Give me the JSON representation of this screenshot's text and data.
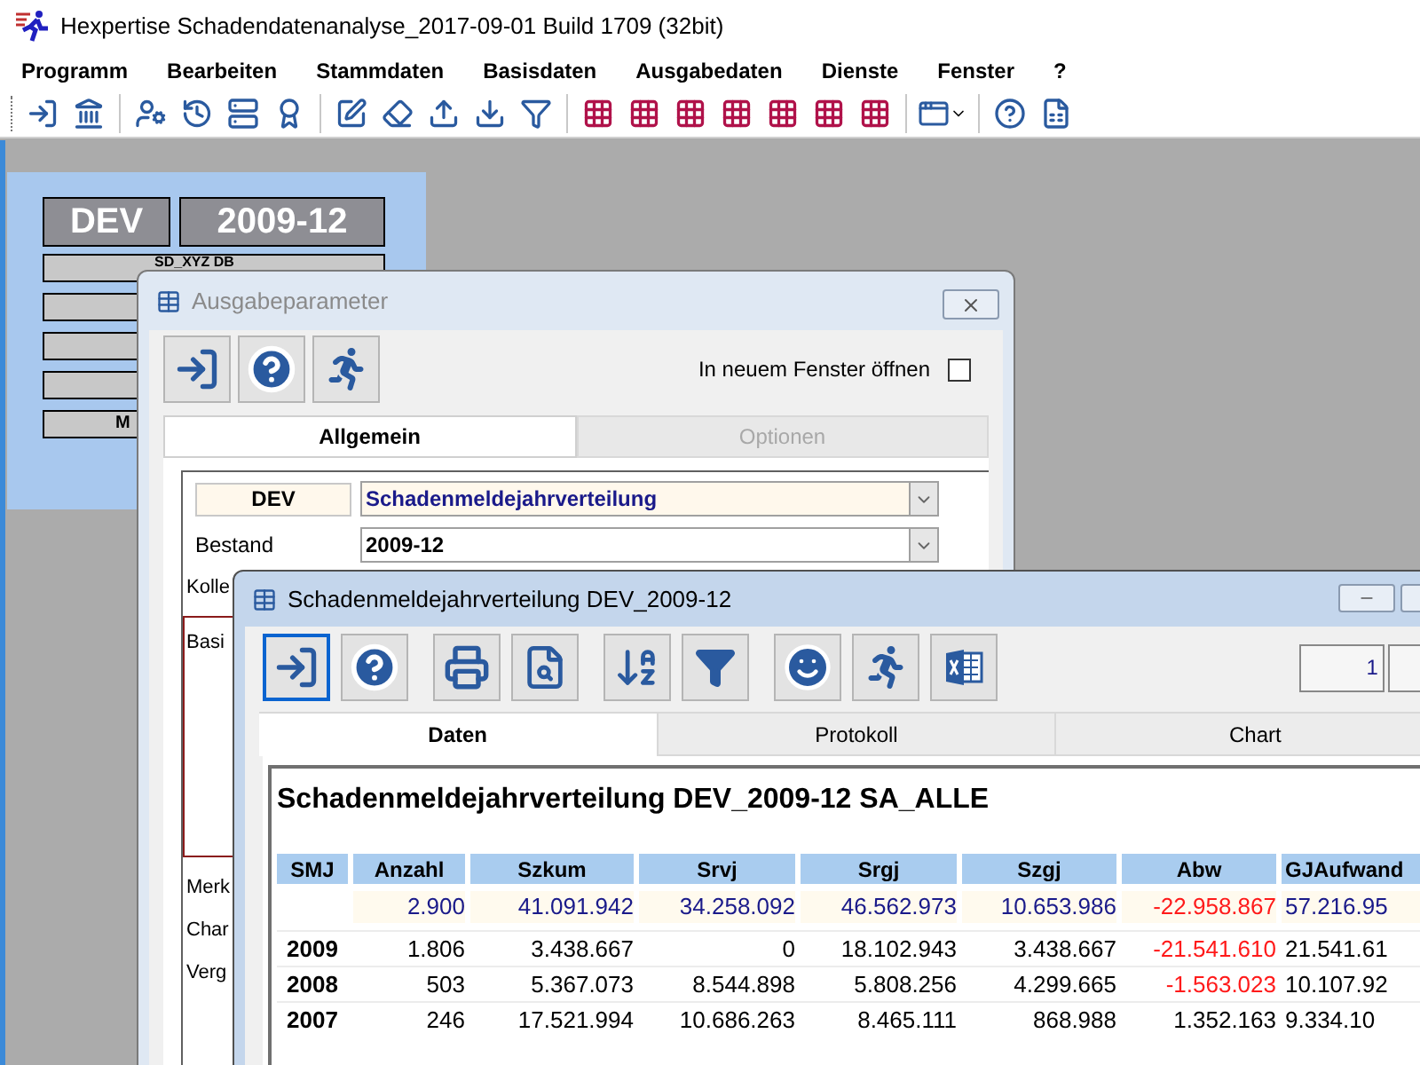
{
  "window": {
    "title": "Hexpertise Schadendatenanalyse_2017-09-01 Build 1709 (32bit)"
  },
  "menu": [
    "Programm",
    "Bearbeiten",
    "Stammdaten",
    "Basisdaten",
    "Ausgabedaten",
    "Dienste",
    "Fenster",
    "?"
  ],
  "status_panel": {
    "tiles": [
      "DEV",
      "2009-12"
    ],
    "rows": [
      {
        "kind": "label",
        "label": "SD_XYZ DB"
      },
      {
        "kind": "blank"
      },
      {
        "kind": "blank"
      },
      {
        "kind": "blank"
      },
      {
        "kind": "label",
        "label": "M"
      }
    ]
  },
  "parameter_dialog": {
    "title": "Ausgabeparameter",
    "active": false,
    "open_in_new_window": {
      "label": "In neuem Fenster öffnen",
      "checked": false
    },
    "tabs": [
      {
        "label": "Allgemein",
        "selected": true,
        "disabled": false
      },
      {
        "label": "Optionen",
        "selected": false,
        "disabled": true
      }
    ],
    "report": {
      "code": "DEV",
      "value": "Schadenmeldejahrverteilung"
    },
    "fields": [
      {
        "label": "Bestand",
        "value": "2009-12"
      }
    ],
    "labels": [
      "Kolle",
      "Basi",
      "Merk",
      "Char",
      "Verg"
    ]
  },
  "result_window": {
    "title": "Schadenmeldejahrverteilung DEV_2009-12",
    "page_field": "1",
    "tabs": [
      {
        "label": "Daten",
        "selected": true
      },
      {
        "label": "Protokoll",
        "selected": false
      },
      {
        "label": "Chart",
        "selected": false
      }
    ],
    "report_title": "Schadenmeldejahrverteilung DEV_2009-12 SA_ALLE",
    "columns": [
      "SMJ",
      "Anzahl",
      "Szkum",
      "Srvj",
      "Srgj",
      "Szgj",
      "Abw",
      "GJAufwand"
    ],
    "rows": [
      {
        "kind": "total",
        "cells": [
          "",
          "2.900",
          "41.091.942",
          "34.258.092",
          "46.562.973",
          "10.653.986",
          "-22.958.867",
          "57.216.95"
        ],
        "abw_negative": true
      },
      {
        "kind": "year",
        "cells": [
          "2009",
          "1.806",
          "3.438.667",
          "0",
          "18.102.943",
          "3.438.667",
          "-21.541.610",
          "21.541.61"
        ],
        "abw_negative": true
      },
      {
        "kind": "year",
        "cells": [
          "2008",
          "503",
          "5.367.073",
          "8.544.898",
          "5.808.256",
          "4.299.665",
          "-1.563.023",
          "10.107.92"
        ],
        "abw_negative": true
      },
      {
        "kind": "year",
        "cells": [
          "2007",
          "246",
          "17.521.994",
          "10.686.263",
          "8.465.111",
          "868.988",
          "1.352.163",
          "9.334.10"
        ],
        "abw_negative": false
      }
    ]
  }
}
